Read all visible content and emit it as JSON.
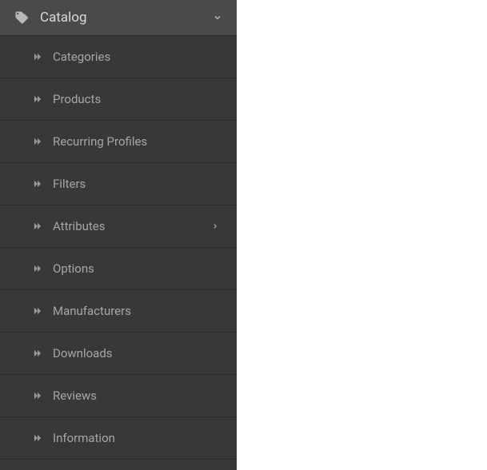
{
  "sidebar": {
    "header": {
      "label": "Catalog"
    },
    "items": [
      {
        "label": "Categories",
        "has_submenu": false
      },
      {
        "label": "Products",
        "has_submenu": false
      },
      {
        "label": "Recurring Profiles",
        "has_submenu": false
      },
      {
        "label": "Filters",
        "has_submenu": false
      },
      {
        "label": "Attributes",
        "has_submenu": true
      },
      {
        "label": "Options",
        "has_submenu": false
      },
      {
        "label": "Manufacturers",
        "has_submenu": false
      },
      {
        "label": "Downloads",
        "has_submenu": false
      },
      {
        "label": "Reviews",
        "has_submenu": false
      },
      {
        "label": "Information",
        "has_submenu": false
      }
    ]
  }
}
